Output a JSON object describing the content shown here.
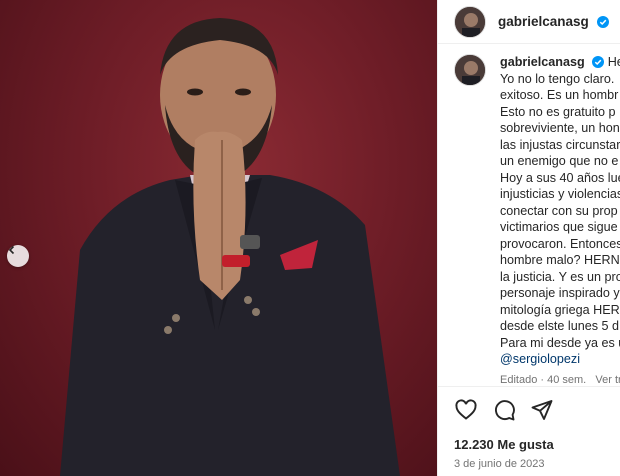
{
  "post": {
    "username": "gabrielcanasg",
    "caption_username": "gabrielcanasg",
    "caption_lines": [
      "Hern",
      "Yo no lo tengo claro.",
      "exitoso. Es un hombr",
      "Esto no es gratuito p",
      "sobreviviente, un hon",
      "las injustas circunstar",
      "un enemigo que no e",
      "Hoy a sus 40 años lue",
      "injusticias y violencias",
      "conectar con su prop",
      "victimarios que sigue",
      "provocaron. Entonces",
      "hombre malo? HERN",
      "la justicia. Y es un pro",
      "personaje inspirado y",
      "mitología griega HER",
      "desde elste lunes 5 d",
      "Para mi desde ya es u"
    ],
    "mention": "@sergiolopezi",
    "edited_meta": "Editado · 40 sem.",
    "see_translation": "Ver tr",
    "likes": "12.230 Me gusta",
    "date": "3 de junio de 2023"
  },
  "colors": {
    "backdrop": "#6e1d27",
    "verified": "#0095f6",
    "mention": "#00376b",
    "muted": "#737373"
  },
  "icons": [
    "chevron-left-icon",
    "verified-icon",
    "heart-icon",
    "comment-icon",
    "share-icon"
  ]
}
